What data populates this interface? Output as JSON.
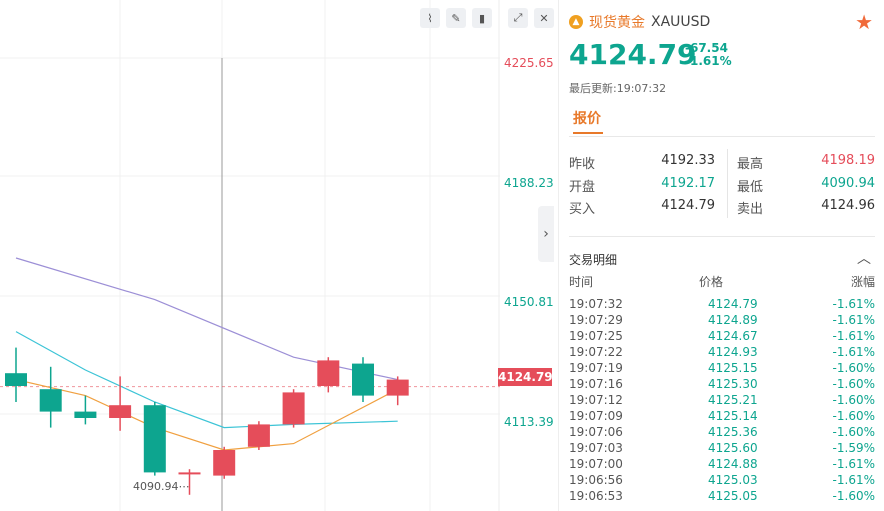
{
  "toolbar": {
    "icons": [
      "line-chart-icon",
      "draw-icon",
      "candlestick-icon",
      "expand-icon",
      "close-icon"
    ]
  },
  "chart": {
    "y_ticks": [
      {
        "label": "4225.65",
        "value": 4225.65,
        "color": "#e54d5a"
      },
      {
        "label": "4188.23",
        "value": 4188.23,
        "color": "#0da58f"
      },
      {
        "label": "4150.81",
        "value": 4150.81,
        "color": "#0da58f"
      },
      {
        "label": "4113.39",
        "value": 4113.39,
        "color": "#0da58f"
      }
    ],
    "current_price_tag": "4124.79",
    "low_label": "4090.94",
    "up_color": "#e54d5a",
    "down_color": "#0da58f"
  },
  "chart_data": {
    "type": "candlestick",
    "ylim": [
      4090,
      4230
    ],
    "candles": [
      {
        "o": 4129,
        "h": 4137,
        "l": 4120,
        "c": 4125
      },
      {
        "o": 4124,
        "h": 4131,
        "l": 4112,
        "c": 4117
      },
      {
        "o": 4117,
        "h": 4122,
        "l": 4113,
        "c": 4115
      },
      {
        "o": 4115,
        "h": 4128,
        "l": 4111,
        "c": 4119
      },
      {
        "o": 4119,
        "h": 4120,
        "l": 4097,
        "c": 4098
      },
      {
        "o": 4098,
        "h": 4099,
        "l": 4091,
        "c": 4098
      },
      {
        "o": 4097,
        "h": 4106,
        "l": 4096,
        "c": 4105
      },
      {
        "o": 4106,
        "h": 4114,
        "l": 4105,
        "c": 4113
      },
      {
        "o": 4113,
        "h": 4124,
        "l": 4112,
        "c": 4123
      },
      {
        "o": 4125,
        "h": 4134,
        "l": 4123,
        "c": 4133
      },
      {
        "o": 4132,
        "h": 4134,
        "l": 4120,
        "c": 4122
      },
      {
        "o": 4122,
        "h": 4128,
        "l": 4119,
        "c": 4127
      }
    ],
    "ma": [
      {
        "color": "#9c8fd6",
        "points": [
          [
            0,
            4165
          ],
          [
            4,
            4152
          ],
          [
            8,
            4134
          ],
          [
            11,
            4127
          ]
        ]
      },
      {
        "color": "#3cc4d6",
        "points": [
          [
            0,
            4142
          ],
          [
            2,
            4130
          ],
          [
            4,
            4120
          ],
          [
            6,
            4112
          ],
          [
            8,
            4113
          ],
          [
            11,
            4114
          ]
        ]
      },
      {
        "color": "#f0a040",
        "points": [
          [
            0,
            4127
          ],
          [
            2,
            4122
          ],
          [
            4,
            4112
          ],
          [
            6,
            4105
          ],
          [
            8,
            4107
          ],
          [
            11,
            4124
          ]
        ]
      }
    ],
    "current": 4124.79
  },
  "panel": {
    "name": "现货黄金",
    "code": "XAUUSD",
    "price": "4124.79",
    "change": "-67.54",
    "change_pct": "-1.61%",
    "updated": "最后更新:19:07:32",
    "tab": "报价",
    "quotes": [
      {
        "l1": "昨收",
        "v1": "4192.33",
        "c1": "",
        "l2": "最高",
        "v2": "4198.19",
        "c2": "red"
      },
      {
        "l1": "开盘",
        "v1": "4192.17",
        "c1": "green",
        "l2": "最低",
        "v2": "4090.94",
        "c2": "green"
      },
      {
        "l1": "买入",
        "v1": "4124.79",
        "c1": "",
        "l2": "卖出",
        "v2": "4124.96",
        "c2": ""
      }
    ],
    "trades_title": "交易明细",
    "columns": {
      "time": "时间",
      "price": "价格",
      "change": "涨幅"
    },
    "trades": [
      {
        "t": "19:07:32",
        "p": "4124.79",
        "c": "-1.61%"
      },
      {
        "t": "19:07:29",
        "p": "4124.89",
        "c": "-1.61%"
      },
      {
        "t": "19:07:25",
        "p": "4124.67",
        "c": "-1.61%"
      },
      {
        "t": "19:07:22",
        "p": "4124.93",
        "c": "-1.61%"
      },
      {
        "t": "19:07:19",
        "p": "4125.15",
        "c": "-1.60%"
      },
      {
        "t": "19:07:16",
        "p": "4125.30",
        "c": "-1.60%"
      },
      {
        "t": "19:07:12",
        "p": "4125.21",
        "c": "-1.60%"
      },
      {
        "t": "19:07:09",
        "p": "4125.14",
        "c": "-1.60%"
      },
      {
        "t": "19:07:06",
        "p": "4125.36",
        "c": "-1.60%"
      },
      {
        "t": "19:07:03",
        "p": "4125.60",
        "c": "-1.59%"
      },
      {
        "t": "19:07:00",
        "p": "4124.88",
        "c": "-1.61%"
      },
      {
        "t": "19:06:56",
        "p": "4125.03",
        "c": "-1.61%"
      },
      {
        "t": "19:06:53",
        "p": "4125.05",
        "c": "-1.60%"
      }
    ]
  }
}
